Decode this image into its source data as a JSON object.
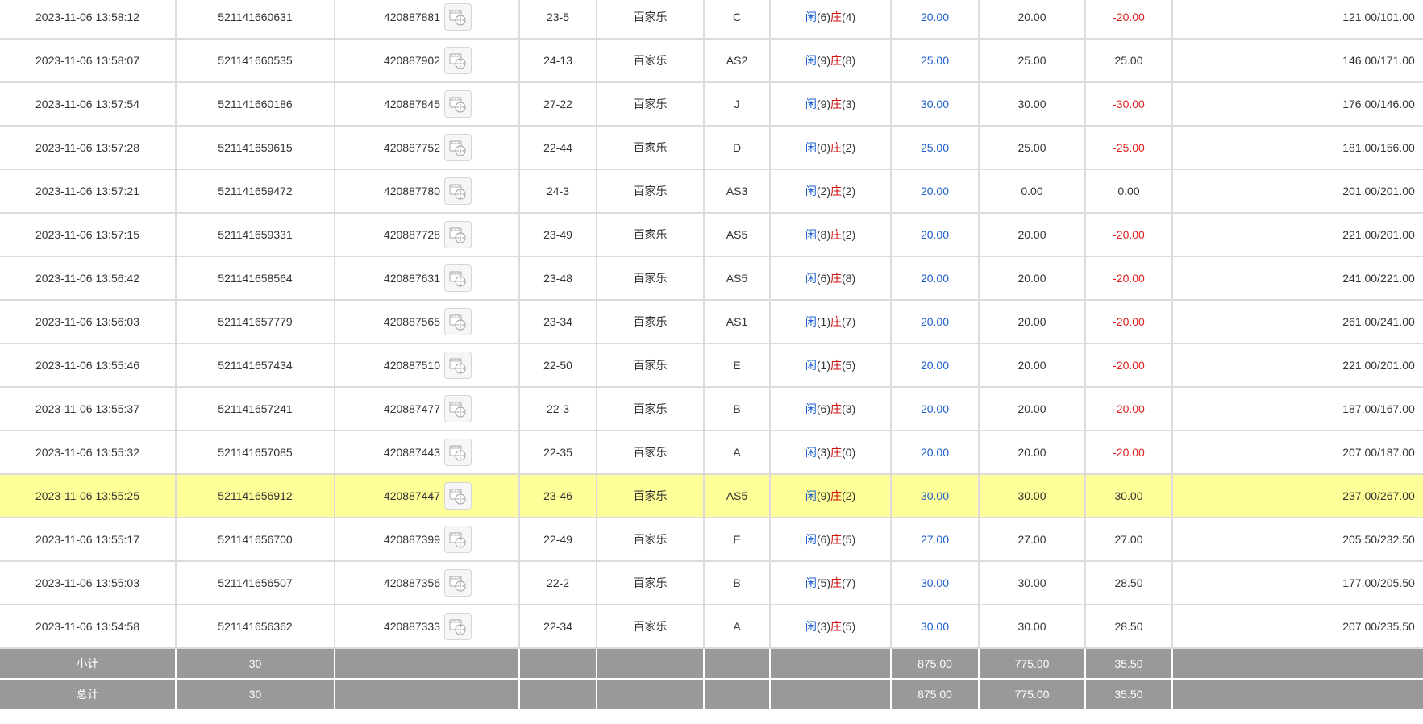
{
  "colors": {
    "player": "#1e5fcc",
    "banker": "#cc1111",
    "negative": "#e02020",
    "highlight_row": "#ffff99",
    "total_row": "#999999"
  },
  "icons": {
    "replay": "video-replay-icon"
  },
  "labels": {
    "player_char": "闲",
    "banker_char": "庄"
  },
  "rows": [
    {
      "time": "2023-11-06 13:58:12",
      "order": "521141660631",
      "wager": "420887881",
      "round": "23-5",
      "game": "百家乐",
      "table": "C",
      "player_pts": "6",
      "banker_pts": "4",
      "bet": "20.00",
      "valid": "20.00",
      "winloss": "-20.00",
      "balance": "121.00/101.00",
      "highlight": false
    },
    {
      "time": "2023-11-06 13:58:07",
      "order": "521141660535",
      "wager": "420887902",
      "round": "24-13",
      "game": "百家乐",
      "table": "AS2",
      "player_pts": "9",
      "banker_pts": "8",
      "bet": "25.00",
      "valid": "25.00",
      "winloss": "25.00",
      "balance": "146.00/171.00",
      "highlight": false
    },
    {
      "time": "2023-11-06 13:57:54",
      "order": "521141660186",
      "wager": "420887845",
      "round": "27-22",
      "game": "百家乐",
      "table": "J",
      "player_pts": "9",
      "banker_pts": "3",
      "bet": "30.00",
      "valid": "30.00",
      "winloss": "-30.00",
      "balance": "176.00/146.00",
      "highlight": false
    },
    {
      "time": "2023-11-06 13:57:28",
      "order": "521141659615",
      "wager": "420887752",
      "round": "22-44",
      "game": "百家乐",
      "table": "D",
      "player_pts": "0",
      "banker_pts": "2",
      "bet": "25.00",
      "valid": "25.00",
      "winloss": "-25.00",
      "balance": "181.00/156.00",
      "highlight": false
    },
    {
      "time": "2023-11-06 13:57:21",
      "order": "521141659472",
      "wager": "420887780",
      "round": "24-3",
      "game": "百家乐",
      "table": "AS3",
      "player_pts": "2",
      "banker_pts": "2",
      "bet": "20.00",
      "valid": "0.00",
      "winloss": "0.00",
      "balance": "201.00/201.00",
      "highlight": false
    },
    {
      "time": "2023-11-06 13:57:15",
      "order": "521141659331",
      "wager": "420887728",
      "round": "23-49",
      "game": "百家乐",
      "table": "AS5",
      "player_pts": "8",
      "banker_pts": "2",
      "bet": "20.00",
      "valid": "20.00",
      "winloss": "-20.00",
      "balance": "221.00/201.00",
      "highlight": false
    },
    {
      "time": "2023-11-06 13:56:42",
      "order": "521141658564",
      "wager": "420887631",
      "round": "23-48",
      "game": "百家乐",
      "table": "AS5",
      "player_pts": "6",
      "banker_pts": "8",
      "bet": "20.00",
      "valid": "20.00",
      "winloss": "-20.00",
      "balance": "241.00/221.00",
      "highlight": false
    },
    {
      "time": "2023-11-06 13:56:03",
      "order": "521141657779",
      "wager": "420887565",
      "round": "23-34",
      "game": "百家乐",
      "table": "AS1",
      "player_pts": "1",
      "banker_pts": "7",
      "bet": "20.00",
      "valid": "20.00",
      "winloss": "-20.00",
      "balance": "261.00/241.00",
      "highlight": false
    },
    {
      "time": "2023-11-06 13:55:46",
      "order": "521141657434",
      "wager": "420887510",
      "round": "22-50",
      "game": "百家乐",
      "table": "E",
      "player_pts": "1",
      "banker_pts": "5",
      "bet": "20.00",
      "valid": "20.00",
      "winloss": "-20.00",
      "balance": "221.00/201.00",
      "highlight": false
    },
    {
      "time": "2023-11-06 13:55:37",
      "order": "521141657241",
      "wager": "420887477",
      "round": "22-3",
      "game": "百家乐",
      "table": "B",
      "player_pts": "6",
      "banker_pts": "3",
      "bet": "20.00",
      "valid": "20.00",
      "winloss": "-20.00",
      "balance": "187.00/167.00",
      "highlight": false
    },
    {
      "time": "2023-11-06 13:55:32",
      "order": "521141657085",
      "wager": "420887443",
      "round": "22-35",
      "game": "百家乐",
      "table": "A",
      "player_pts": "3",
      "banker_pts": "0",
      "bet": "20.00",
      "valid": "20.00",
      "winloss": "-20.00",
      "balance": "207.00/187.00",
      "highlight": false
    },
    {
      "time": "2023-11-06 13:55:25",
      "order": "521141656912",
      "wager": "420887447",
      "round": "23-46",
      "game": "百家乐",
      "table": "AS5",
      "player_pts": "9",
      "banker_pts": "2",
      "bet": "30.00",
      "valid": "30.00",
      "winloss": "30.00",
      "balance": "237.00/267.00",
      "highlight": true
    },
    {
      "time": "2023-11-06 13:55:17",
      "order": "521141656700",
      "wager": "420887399",
      "round": "22-49",
      "game": "百家乐",
      "table": "E",
      "player_pts": "6",
      "banker_pts": "5",
      "bet": "27.00",
      "valid": "27.00",
      "winloss": "27.00",
      "balance": "205.50/232.50",
      "highlight": false
    },
    {
      "time": "2023-11-06 13:55:03",
      "order": "521141656507",
      "wager": "420887356",
      "round": "22-2",
      "game": "百家乐",
      "table": "B",
      "player_pts": "5",
      "banker_pts": "7",
      "bet": "30.00",
      "valid": "30.00",
      "winloss": "28.50",
      "balance": "177.00/205.50",
      "highlight": false
    },
    {
      "time": "2023-11-06 13:54:58",
      "order": "521141656362",
      "wager": "420887333",
      "round": "22-34",
      "game": "百家乐",
      "table": "A",
      "player_pts": "3",
      "banker_pts": "5",
      "bet": "30.00",
      "valid": "30.00",
      "winloss": "28.50",
      "balance": "207.00/235.50",
      "highlight": false
    }
  ],
  "totals": [
    {
      "label": "小计",
      "count": "30",
      "bet": "875.00",
      "valid": "775.00",
      "winloss": "35.50"
    },
    {
      "label": "总计",
      "count": "30",
      "bet": "875.00",
      "valid": "775.00",
      "winloss": "35.50"
    }
  ]
}
